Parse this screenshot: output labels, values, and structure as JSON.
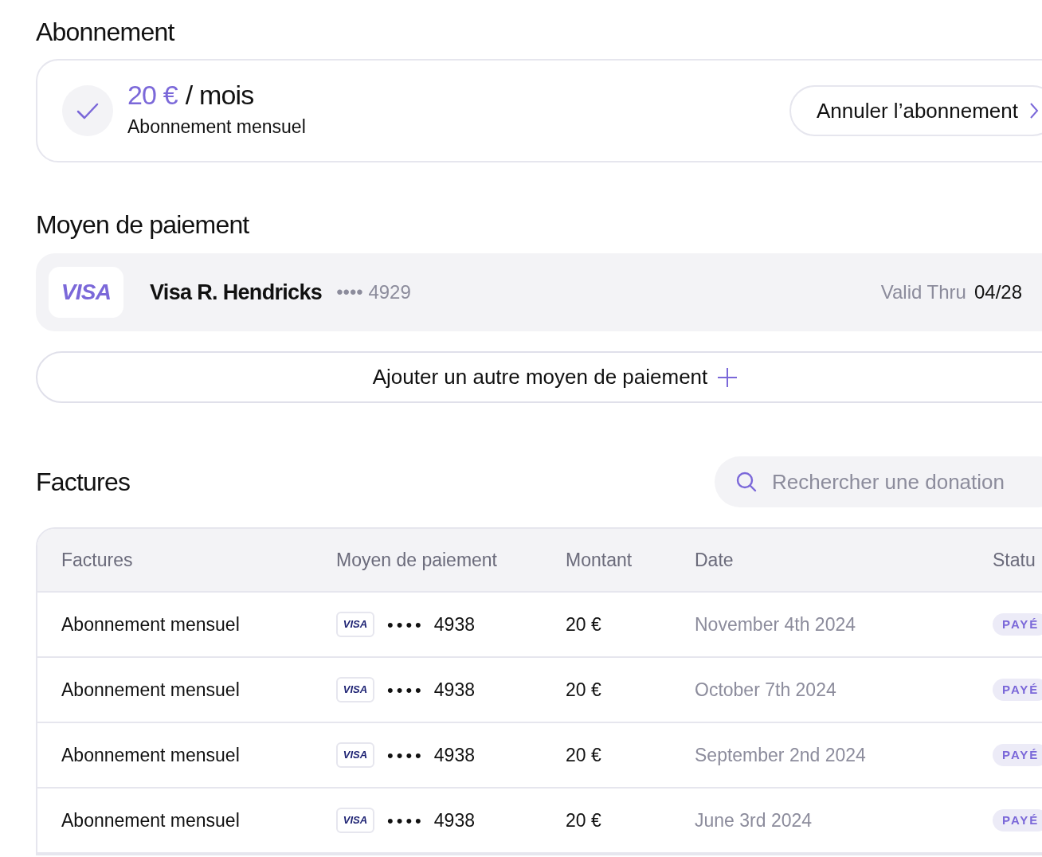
{
  "subscription": {
    "title": "Abonnement",
    "price": "20 €",
    "period": "/ mois",
    "plan": "Abonnement mensuel",
    "cancel_button": "Annuler l’abonnement"
  },
  "payment": {
    "title": "Moyen de paiement",
    "card": {
      "brand": "VISA",
      "holder": "Visa R. Hendricks",
      "masked": "•••• 4929",
      "valid_label": "Valid Thru",
      "expiry": "04/28"
    },
    "add_button": "Ajouter un autre moyen de paiement"
  },
  "invoices": {
    "title": "Factures",
    "search": {
      "placeholder": "Rechercher une donation"
    },
    "table": {
      "columns": [
        "Factures",
        "Moyen de paiement",
        "Montant",
        "Date",
        "Statu"
      ],
      "rows": [
        {
          "invoice": "Abonnement mensuel",
          "card_brand": "VISA",
          "masked": "••••",
          "last4": "4938",
          "amount": "20 €",
          "date": "November 4th 2024",
          "status": "PAYÉ"
        },
        {
          "invoice": "Abonnement mensuel",
          "card_brand": "VISA",
          "masked": "••••",
          "last4": "4938",
          "amount": "20 €",
          "date": "October 7th 2024",
          "status": "PAYÉ"
        },
        {
          "invoice": "Abonnement mensuel",
          "card_brand": "VISA",
          "masked": "••••",
          "last4": "4938",
          "amount": "20 €",
          "date": "September 2nd 2024",
          "status": "PAYÉ"
        },
        {
          "invoice": "Abonnement mensuel",
          "card_brand": "VISA",
          "masked": "••••",
          "last4": "4938",
          "amount": "20 €",
          "date": "June 3rd 2024",
          "status": "PAYÉ"
        }
      ]
    }
  }
}
